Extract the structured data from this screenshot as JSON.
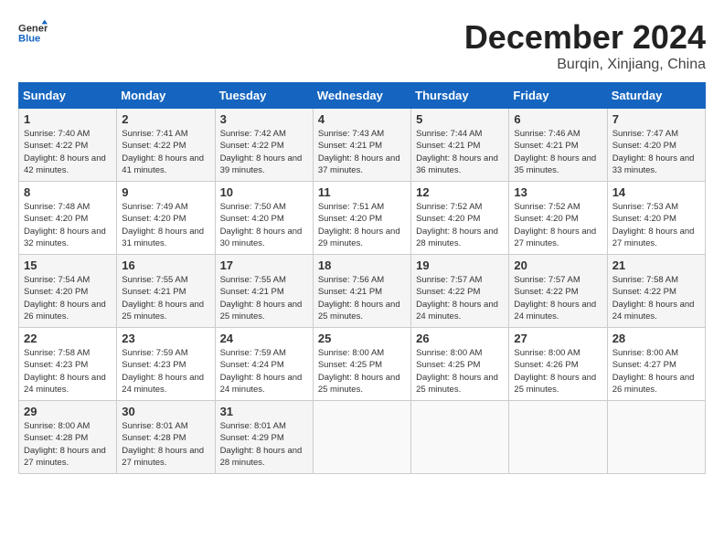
{
  "header": {
    "logo_line1": "General",
    "logo_line2": "Blue",
    "month_year": "December 2024",
    "location": "Burqin, Xinjiang, China"
  },
  "days_of_week": [
    "Sunday",
    "Monday",
    "Tuesday",
    "Wednesday",
    "Thursday",
    "Friday",
    "Saturday"
  ],
  "weeks": [
    [
      {
        "day": "1",
        "sunrise": "7:40 AM",
        "sunset": "4:22 PM",
        "daylight": "8 hours and 42 minutes."
      },
      {
        "day": "2",
        "sunrise": "7:41 AM",
        "sunset": "4:22 PM",
        "daylight": "8 hours and 41 minutes."
      },
      {
        "day": "3",
        "sunrise": "7:42 AM",
        "sunset": "4:22 PM",
        "daylight": "8 hours and 39 minutes."
      },
      {
        "day": "4",
        "sunrise": "7:43 AM",
        "sunset": "4:21 PM",
        "daylight": "8 hours and 37 minutes."
      },
      {
        "day": "5",
        "sunrise": "7:44 AM",
        "sunset": "4:21 PM",
        "daylight": "8 hours and 36 minutes."
      },
      {
        "day": "6",
        "sunrise": "7:46 AM",
        "sunset": "4:21 PM",
        "daylight": "8 hours and 35 minutes."
      },
      {
        "day": "7",
        "sunrise": "7:47 AM",
        "sunset": "4:20 PM",
        "daylight": "8 hours and 33 minutes."
      }
    ],
    [
      {
        "day": "8",
        "sunrise": "7:48 AM",
        "sunset": "4:20 PM",
        "daylight": "8 hours and 32 minutes."
      },
      {
        "day": "9",
        "sunrise": "7:49 AM",
        "sunset": "4:20 PM",
        "daylight": "8 hours and 31 minutes."
      },
      {
        "day": "10",
        "sunrise": "7:50 AM",
        "sunset": "4:20 PM",
        "daylight": "8 hours and 30 minutes."
      },
      {
        "day": "11",
        "sunrise": "7:51 AM",
        "sunset": "4:20 PM",
        "daylight": "8 hours and 29 minutes."
      },
      {
        "day": "12",
        "sunrise": "7:52 AM",
        "sunset": "4:20 PM",
        "daylight": "8 hours and 28 minutes."
      },
      {
        "day": "13",
        "sunrise": "7:52 AM",
        "sunset": "4:20 PM",
        "daylight": "8 hours and 27 minutes."
      },
      {
        "day": "14",
        "sunrise": "7:53 AM",
        "sunset": "4:20 PM",
        "daylight": "8 hours and 27 minutes."
      }
    ],
    [
      {
        "day": "15",
        "sunrise": "7:54 AM",
        "sunset": "4:20 PM",
        "daylight": "8 hours and 26 minutes."
      },
      {
        "day": "16",
        "sunrise": "7:55 AM",
        "sunset": "4:21 PM",
        "daylight": "8 hours and 25 minutes."
      },
      {
        "day": "17",
        "sunrise": "7:55 AM",
        "sunset": "4:21 PM",
        "daylight": "8 hours and 25 minutes."
      },
      {
        "day": "18",
        "sunrise": "7:56 AM",
        "sunset": "4:21 PM",
        "daylight": "8 hours and 25 minutes."
      },
      {
        "day": "19",
        "sunrise": "7:57 AM",
        "sunset": "4:22 PM",
        "daylight": "8 hours and 24 minutes."
      },
      {
        "day": "20",
        "sunrise": "7:57 AM",
        "sunset": "4:22 PM",
        "daylight": "8 hours and 24 minutes."
      },
      {
        "day": "21",
        "sunrise": "7:58 AM",
        "sunset": "4:22 PM",
        "daylight": "8 hours and 24 minutes."
      }
    ],
    [
      {
        "day": "22",
        "sunrise": "7:58 AM",
        "sunset": "4:23 PM",
        "daylight": "8 hours and 24 minutes."
      },
      {
        "day": "23",
        "sunrise": "7:59 AM",
        "sunset": "4:23 PM",
        "daylight": "8 hours and 24 minutes."
      },
      {
        "day": "24",
        "sunrise": "7:59 AM",
        "sunset": "4:24 PM",
        "daylight": "8 hours and 24 minutes."
      },
      {
        "day": "25",
        "sunrise": "8:00 AM",
        "sunset": "4:25 PM",
        "daylight": "8 hours and 25 minutes."
      },
      {
        "day": "26",
        "sunrise": "8:00 AM",
        "sunset": "4:25 PM",
        "daylight": "8 hours and 25 minutes."
      },
      {
        "day": "27",
        "sunrise": "8:00 AM",
        "sunset": "4:26 PM",
        "daylight": "8 hours and 25 minutes."
      },
      {
        "day": "28",
        "sunrise": "8:00 AM",
        "sunset": "4:27 PM",
        "daylight": "8 hours and 26 minutes."
      }
    ],
    [
      {
        "day": "29",
        "sunrise": "8:00 AM",
        "sunset": "4:28 PM",
        "daylight": "8 hours and 27 minutes."
      },
      {
        "day": "30",
        "sunrise": "8:01 AM",
        "sunset": "4:28 PM",
        "daylight": "8 hours and 27 minutes."
      },
      {
        "day": "31",
        "sunrise": "8:01 AM",
        "sunset": "4:29 PM",
        "daylight": "8 hours and 28 minutes."
      },
      null,
      null,
      null,
      null
    ]
  ]
}
